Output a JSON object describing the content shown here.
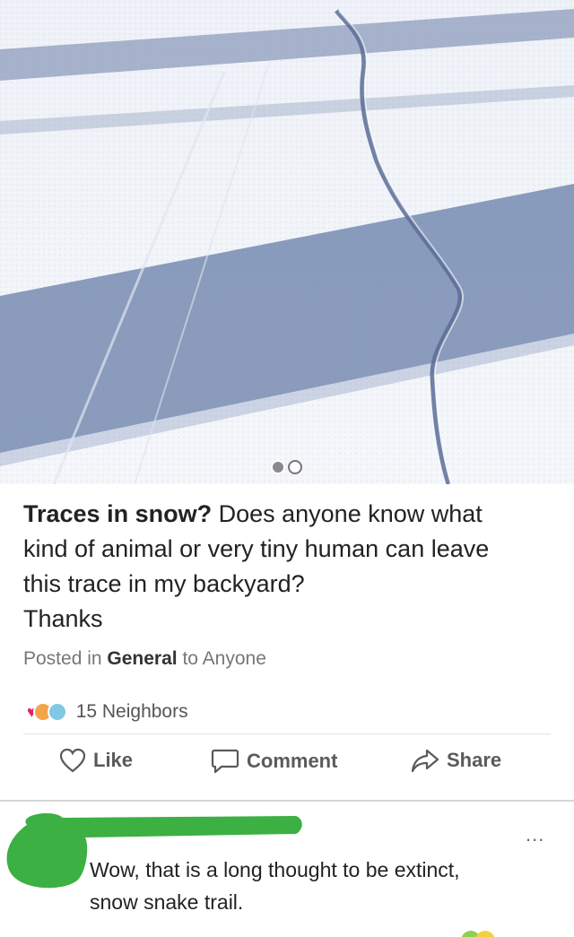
{
  "post": {
    "photo_alt": "",
    "title": "Traces in snow?",
    "body_line1": "Does anyone know what",
    "body_line2": "kind of animal or very tiny human can leave",
    "body_line3": "this trace in my backyard?",
    "body_line4": "Thanks",
    "posted_prefix": "Posted in",
    "category": "General",
    "posted_to": "to Anyone"
  },
  "reactions": {
    "count_label": "15 Neighbors",
    "icons": [
      "heart-icon",
      "surprised-emoji-icon",
      "cold-emoji-icon"
    ]
  },
  "actions": {
    "like": "Like",
    "comment": "Comment",
    "share": "Share"
  },
  "comment": {
    "line1": "Wow, that is a long thought to be extinct,",
    "line2": "snow snake trail.",
    "more": "..."
  },
  "colors": {
    "redaction": "#3cb043",
    "heart": "#e0245e",
    "snow": "#eef2f8",
    "shadow": "#6f84ad"
  }
}
